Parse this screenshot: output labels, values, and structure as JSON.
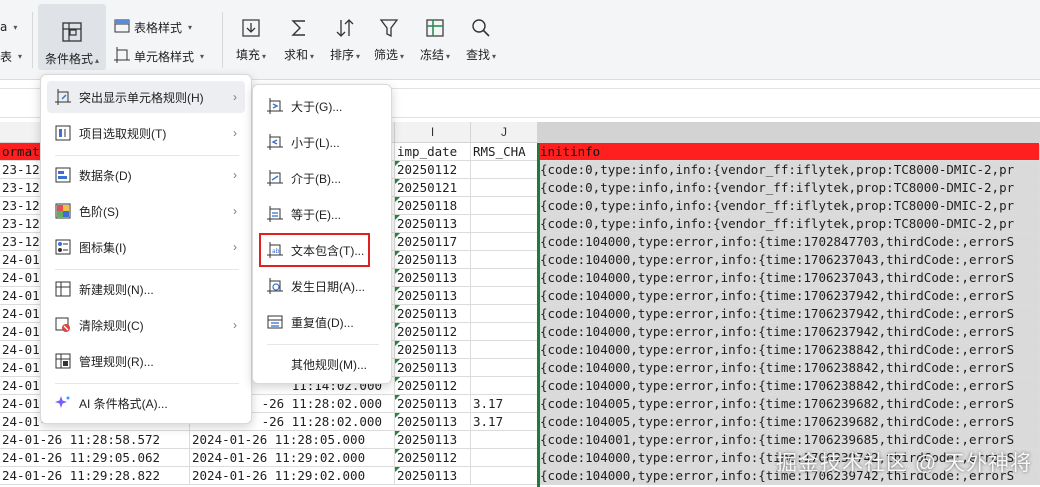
{
  "ribbon": {
    "conditional_format": "条件格式",
    "table_style": "表格样式",
    "cell_style": "单元格样式",
    "fill": "填充",
    "sum": "求和",
    "sort": "排序",
    "filter": "筛选",
    "freeze": "冻结",
    "find": "查找",
    "left_partial_top": "a",
    "left_partial_bottom": "表"
  },
  "columns": [
    {
      "id": "col-h",
      "label": ""
    },
    {
      "id": "col-i",
      "label": "I"
    },
    {
      "id": "col-j",
      "label": "J"
    }
  ],
  "header_row": {
    "a": "ormate",
    "i": "imp_date",
    "j": "RMS_CHA",
    "k": "initinfo"
  },
  "rows": [
    {
      "a": "23-12-",
      "h": "",
      "i": "20250112",
      "j": "",
      "k": "{code:0,type:info,info:{vendor_ff:iflytek,prop:TC8000-DMIC-2,pr"
    },
    {
      "a": "23-12-",
      "h": "",
      "i": "20250121",
      "j": "",
      "k": "{code:0,type:info,info:{vendor_ff:iflytek,prop:TC8000-DMIC-2,pr"
    },
    {
      "a": "23-12-",
      "h": "",
      "i": "20250118",
      "j": "",
      "k": "{code:0,type:info,info:{vendor_ff:iflytek,prop:TC8000-DMIC-2,pr"
    },
    {
      "a": "23-12-",
      "h": "",
      "i": "20250113",
      "j": "",
      "k": "{code:0,type:info,info:{vendor_ff:iflytek,prop:TC8000-DMIC-2,pr"
    },
    {
      "a": "23-12-",
      "h": "",
      "i": "20250117",
      "j": "",
      "k": "{code:104000,type:error,info:{time:1702847703,thirdCode:,errorS"
    },
    {
      "a": "24-01-",
      "h": "",
      "i": "20250113",
      "j": "",
      "k": "{code:104000,type:error,info:{time:1706237043,thirdCode:,errorS"
    },
    {
      "a": "24-01-",
      "h": "",
      "i": "20250113",
      "j": "",
      "k": "{code:104000,type:error,info:{time:1706237043,thirdCode:,errorS"
    },
    {
      "a": "24-01-",
      "h": "",
      "i": "20250113",
      "j": "",
      "k": "{code:104000,type:error,info:{time:1706237942,thirdCode:,errorS"
    },
    {
      "a": "24-01-",
      "h": "",
      "i": "20250113",
      "j": "",
      "k": "{code:104000,type:error,info:{time:1706237942,thirdCode:,errorS"
    },
    {
      "a": "24-01-",
      "h": "",
      "i": "20250112",
      "j": "",
      "k": "{code:104000,type:error,info:{time:1706237942,thirdCode:,errorS"
    },
    {
      "a": "24-01-",
      "h": "",
      "i": "20250113",
      "j": "",
      "k": "{code:104000,type:error,info:{time:1706238842,thirdCode:,errorS"
    },
    {
      "a": "24-01-",
      "h": "",
      "i": "20250113",
      "j": "",
      "k": "{code:104000,type:error,info:{time:1706238842,thirdCode:,errorS"
    },
    {
      "a": "24-01-",
      "h": "11:14:02.000",
      "i": "20250112",
      "j": "",
      "k": "{code:104000,type:error,info:{time:1706238842,thirdCode:,errorS"
    },
    {
      "a": "24-01-",
      "h": "-26 11:28:02.000",
      "i": "20250113",
      "j": "3.17",
      "k": "{code:104005,type:error,info:{time:1706239682,thirdCode:,errorS"
    },
    {
      "a": "24-01-",
      "h": "-26 11:28:02.000",
      "i": "20250113",
      "j": "3.17",
      "k": "{code:104005,type:error,info:{time:1706239682,thirdCode:,errorS"
    },
    {
      "a": "24-01-26 11:28:58.572",
      "h": "2024-01-26 11:28:05.000",
      "i": "20250113",
      "j": "",
      "k": "{code:104001,type:error,info:{time:1706239685,thirdCode:,errorS"
    },
    {
      "a": "24-01-26 11:29:05.062",
      "h": "2024-01-26 11:29:02.000",
      "i": "20250112",
      "j": "",
      "k": "{code:104000,type:error,info:{time:1706239742,thirdCode:,errorS"
    },
    {
      "a": "24-01-26 11:29:28.822",
      "h": "2024-01-26 11:29:02.000",
      "i": "20250113",
      "j": "",
      "k": "{code:104000,type:error,info:{time:1706239742,thirdCode:,errorS"
    }
  ],
  "menu_main": {
    "items": [
      "突出显示单元格规则(H)",
      "项目选取规则(T)",
      "数据条(D)",
      "色阶(S)",
      "图标集(I)",
      "新建规则(N)...",
      "清除规则(C)",
      "管理规则(R)...",
      "AI 条件格式(A)..."
    ]
  },
  "menu_sub": {
    "items": [
      "大于(G)...",
      "小于(L)...",
      "介于(B)...",
      "等于(E)...",
      "文本包含(T)...",
      "发生日期(A)...",
      "重复值(D)...",
      "其他规则(M)..."
    ]
  },
  "watermark": "掘金技术社区 @ 天外神将",
  "colors": {
    "header_red": "#ff1f1f",
    "selected_grey": "#dadada",
    "highlight_box": "#e02020",
    "green_marker": "#1d8a3b"
  }
}
